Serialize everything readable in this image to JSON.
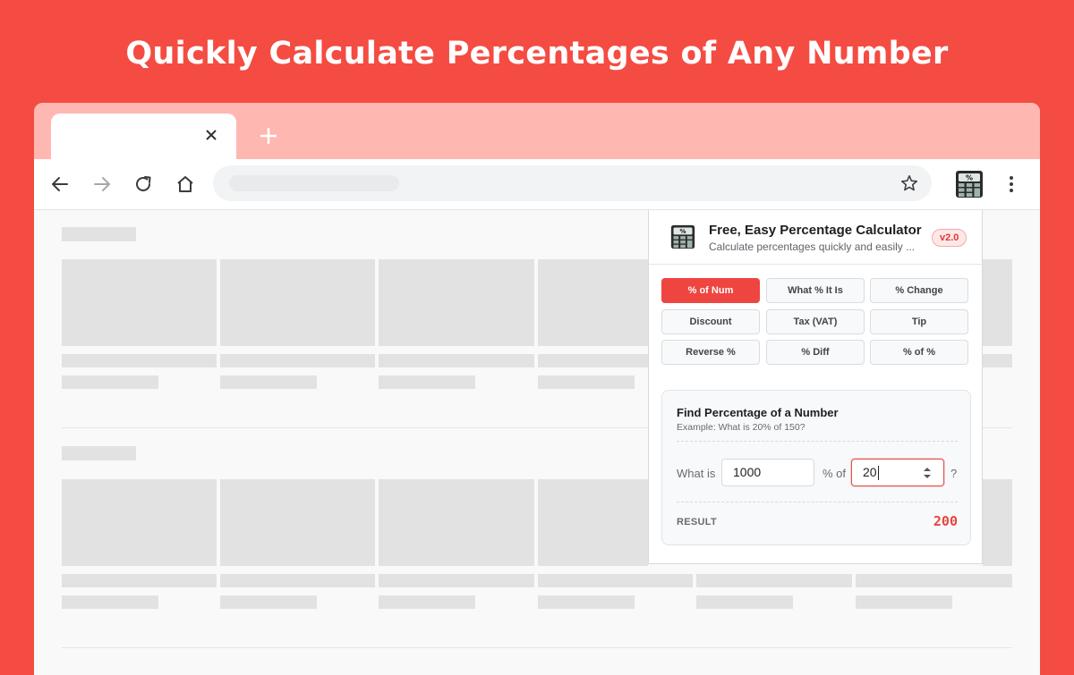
{
  "headline": "Quickly Calculate Percentages of Any Number",
  "colors": {
    "background": "#f44c43",
    "tab_strip": "#ffb7b1",
    "accent": "#ef4540",
    "result": "#e8453f"
  },
  "browser": {
    "icons": [
      "back-arrow-icon",
      "forward-arrow-icon",
      "reload-icon",
      "home-icon",
      "star-icon",
      "extension-calculator-icon",
      "more-menu-icon",
      "close-icon",
      "plus-icon"
    ]
  },
  "popup": {
    "title": "Free, Easy Percentage Calculator",
    "subtitle": "Calculate percentages quickly and easily ...",
    "version": "v2.0",
    "modes": [
      "% of Num",
      "What % It Is",
      "% Change",
      "Discount",
      "Tax (VAT)",
      "Tip",
      "Reverse %",
      "% Diff",
      "% of %"
    ],
    "active_mode": "% of Num",
    "card": {
      "title": "Find Percentage of a Number",
      "example": "Example: What is 20% of 150?",
      "label_what_is": "What is",
      "number_value": "1000",
      "label_percent_of": "% of",
      "percent_value": "20",
      "label_question": "?",
      "result_label": "RESULT",
      "result_value": "200"
    }
  }
}
